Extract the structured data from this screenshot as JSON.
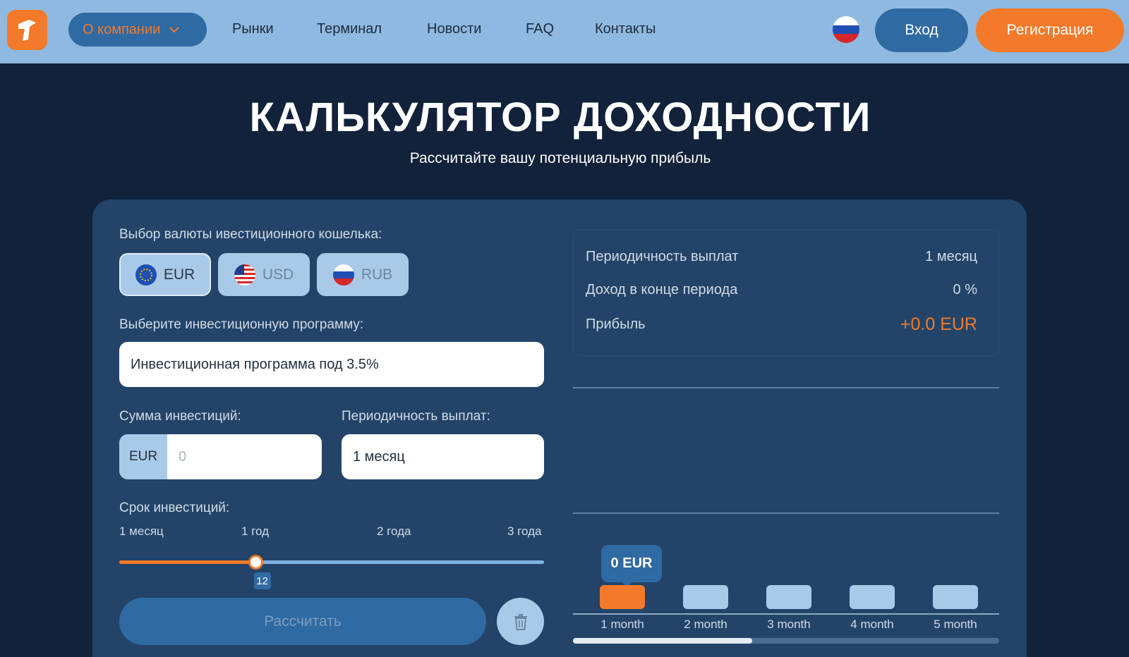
{
  "nav": {
    "about": "О компании",
    "links": [
      "Рынки",
      "Терминал",
      "Новости",
      "FAQ",
      "Контакты"
    ],
    "login": "Вход",
    "register": "Регистрация",
    "language_icon": "flag-ru-icon"
  },
  "hero": {
    "title": "КАЛЬКУЛЯТОР ДОХОДНОСТИ",
    "subtitle": "Рассчитайте вашу потенциальную прибыль"
  },
  "form": {
    "currency_label": "Выбор валюты ивестиционного кошелька:",
    "currencies": [
      "EUR",
      "USD",
      "RUB"
    ],
    "selected_currency": "EUR",
    "program_label": "Выберите инвестиционную программу:",
    "program_value": "Инвестиционная программа под 3.5%",
    "amount_label": "Сумма инвестиций:",
    "amount_currency": "EUR",
    "amount_placeholder": "0",
    "payout_label": "Периодичность выплат:",
    "payout_value": "1 месяц",
    "term_label": "Срок инвестиций:",
    "term_ticks": [
      "1 месяц",
      "1 год",
      "2 года",
      "3 года"
    ],
    "term_value": "12",
    "term_fraction": 0.32,
    "calculate": "Рассчитать"
  },
  "summary": {
    "rows": [
      {
        "label": "Периодичность выплат",
        "value": "1 месяц"
      },
      {
        "label": "Доход в конце периода",
        "value": "0 %"
      },
      {
        "label": "Прибыль",
        "value": "+0.0 EUR"
      }
    ]
  },
  "chart_data": {
    "type": "bar",
    "categories": [
      "1 month",
      "2 month",
      "3 month",
      "4 month",
      "5 month"
    ],
    "tooltip": "0 EUR",
    "active_index": 0
  },
  "colors": {
    "accent": "#f27a2a",
    "primary": "#2f6aa3",
    "header": "#8fb9e0",
    "background": "#11223a",
    "card": "#234468"
  }
}
